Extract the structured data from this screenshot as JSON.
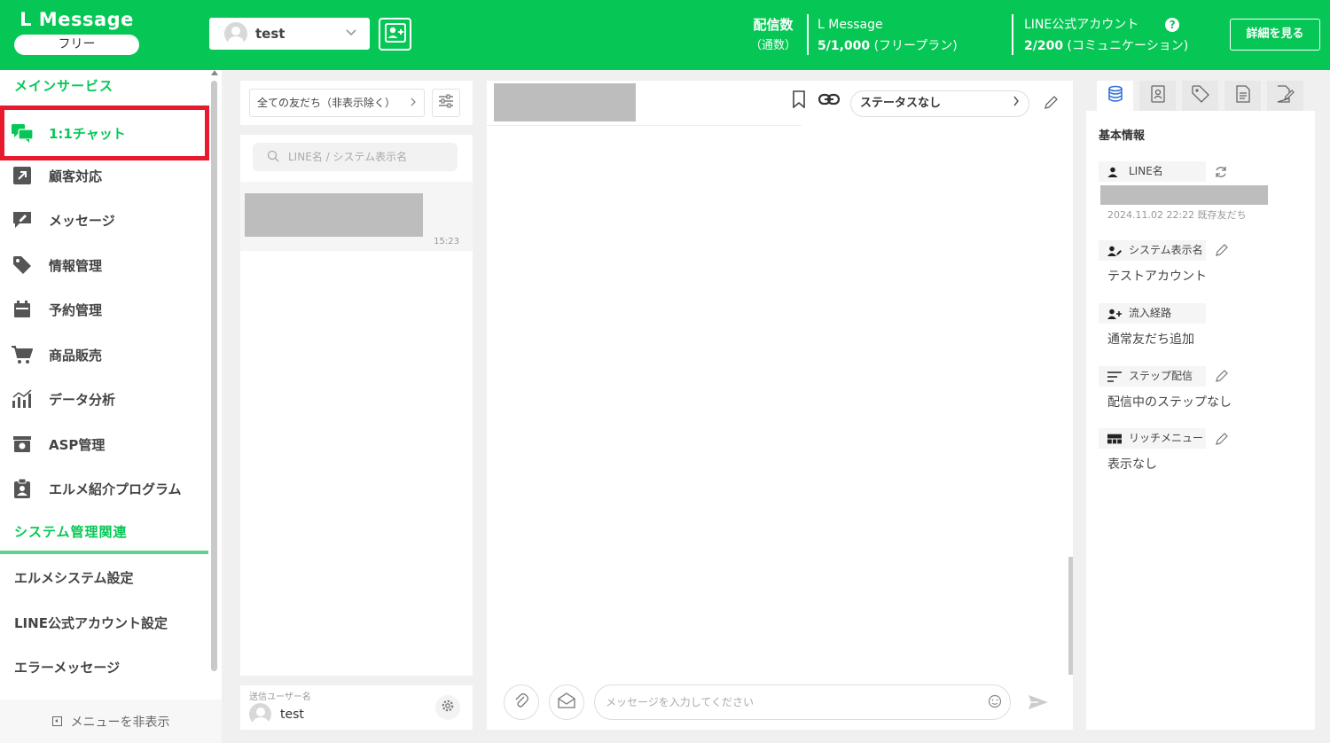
{
  "header": {
    "logo_title": "L Message",
    "plan": "フリー",
    "account_name": "test",
    "stat1_label": "配信数",
    "stat1_sub": "（通数）",
    "stat2_label": "L Message",
    "stat2_value": "5/1,000",
    "stat2_note": "(フリープラン)",
    "stat3_label": "LINE公式アカウント",
    "stat3_value": "2/200",
    "stat3_note": "(コミュニケーション)",
    "details_button": "詳細を見る",
    "help_glyph": "?",
    "brand_color": "#06c755"
  },
  "sidebar": {
    "main_section": "メインサービス",
    "items": [
      {
        "label": "1:1チャット"
      },
      {
        "label": "顧客対応"
      },
      {
        "label": "メッセージ"
      },
      {
        "label": "情報管理"
      },
      {
        "label": "予約管理"
      },
      {
        "label": "商品販売"
      },
      {
        "label": "データ分析"
      },
      {
        "label": "ASP管理"
      },
      {
        "label": "エルメ紹介プログラム"
      }
    ],
    "system_section": "システム管理関連",
    "system_items": [
      {
        "label": "エルメシステム設定"
      },
      {
        "label": "LINE公式アカウント設定"
      },
      {
        "label": "エラーメッセージ"
      }
    ],
    "hide_menu": "メニューを非表示",
    "active_color": "#e8192c"
  },
  "friends": {
    "filter": "全ての友だち（非表示除く）",
    "search_placeholder": "LINE名 / システム表示名",
    "items": [
      {
        "time": "15:23"
      }
    ],
    "sender_label": "送信ユーザー名",
    "sender_name": "test"
  },
  "chat": {
    "status": "ステータスなし",
    "input_placeholder": "メッセージを入力してください"
  },
  "info": {
    "title": "基本情報",
    "line_name_label": "LINE名",
    "line_meta": "2024.11.02 22:22 既存友だち",
    "system_name_label": "システム表示名",
    "system_name_value": "テストアカウント",
    "route_label": "流入経路",
    "route_value": "通常友だち追加",
    "step_label": "ステップ配信",
    "step_value": "配信中のステップなし",
    "rich_label": "リッチメニュー",
    "rich_value": "表示なし"
  }
}
